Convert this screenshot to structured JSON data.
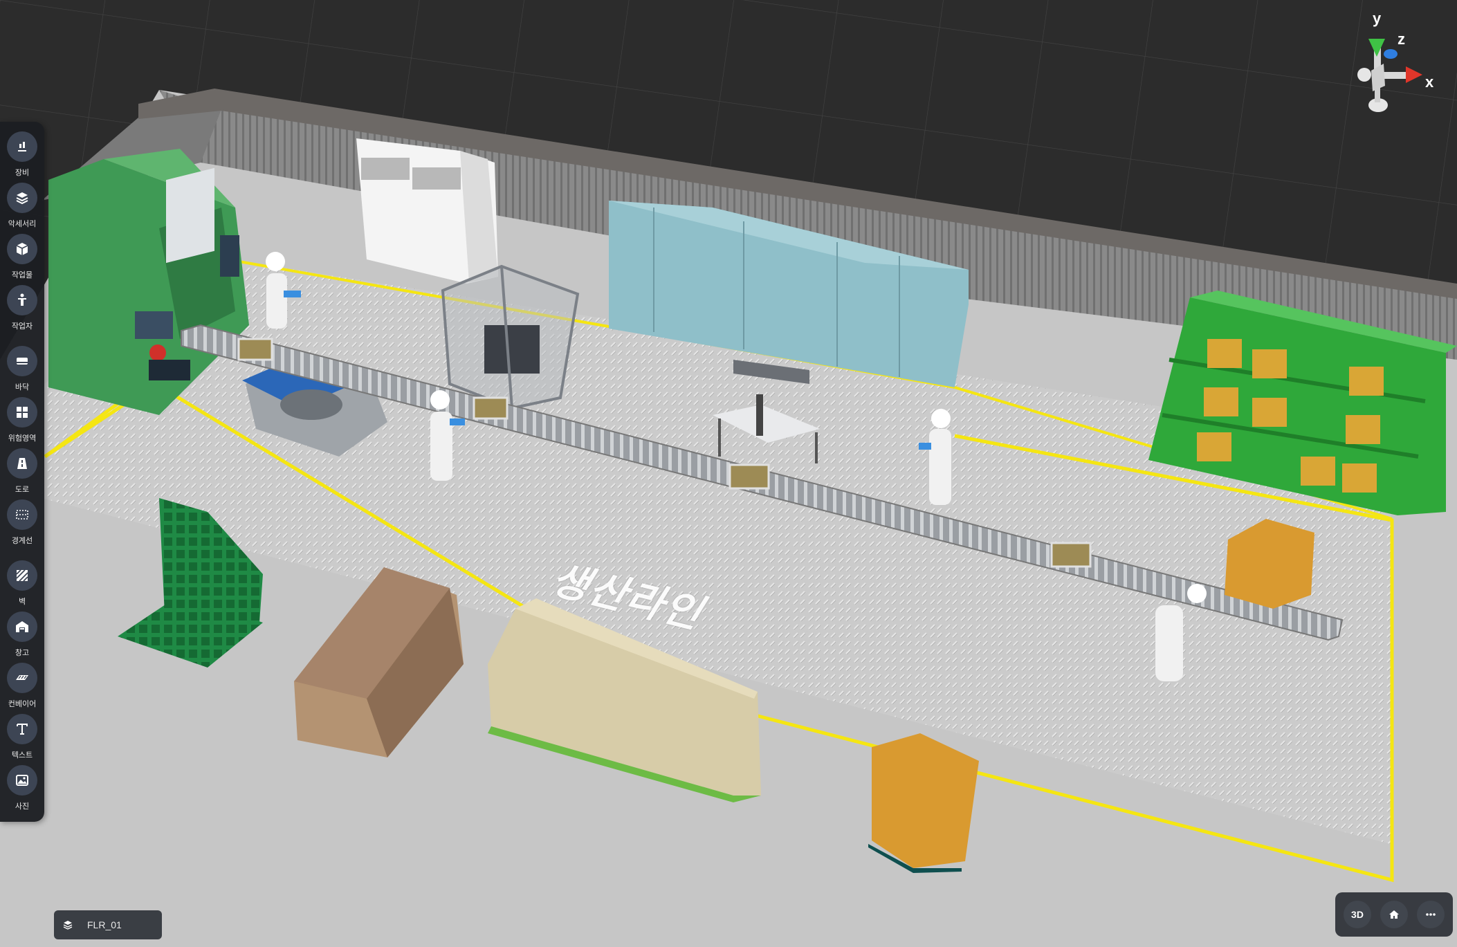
{
  "toolbar": {
    "items": [
      {
        "label": "장비",
        "icon": "equipment-icon"
      },
      {
        "label": "악세서리",
        "icon": "accessory-icon"
      },
      {
        "label": "작업물",
        "icon": "workpiece-icon"
      },
      {
        "label": "작업자",
        "icon": "worker-icon"
      },
      {
        "label": "바닥",
        "icon": "floor-icon"
      },
      {
        "label": "위험영역",
        "icon": "danger-zone-icon"
      },
      {
        "label": "도로",
        "icon": "road-icon"
      },
      {
        "label": "경계선",
        "icon": "boundary-icon"
      },
      {
        "label": "벽",
        "icon": "wall-icon"
      },
      {
        "label": "창고",
        "icon": "warehouse-icon"
      },
      {
        "label": "컨베이어",
        "icon": "conveyor-icon"
      },
      {
        "label": "텍스트",
        "icon": "text-icon"
      },
      {
        "label": "사진",
        "icon": "photo-icon"
      }
    ]
  },
  "scene": {
    "label": "생산라인"
  },
  "floor_selector": {
    "value": "FLR_01",
    "icon": "layers-icon"
  },
  "view_controls": {
    "mode_label": "3D",
    "home_icon": "home-icon",
    "more_icon": "more-icon"
  },
  "axes": {
    "x": "x",
    "y": "y",
    "z": "z"
  },
  "colors": {
    "toolbar_bg": "#1c1e22",
    "tool_icon_bg": "#3d4554",
    "zone_outline": "#f5e612",
    "machine_green": "#3f9a55",
    "cabinet_blue": "#8fbfc9",
    "rack_green": "#2fa83a",
    "floor": "#c8c8c8",
    "background": "#2c2c2c"
  }
}
